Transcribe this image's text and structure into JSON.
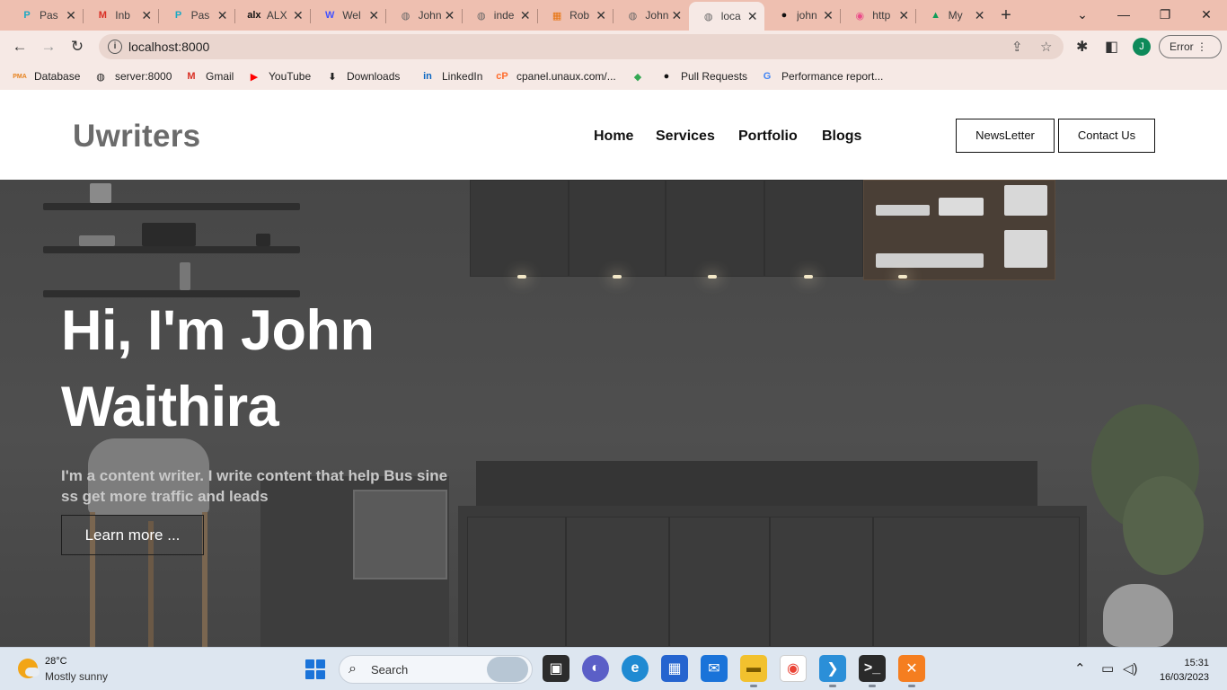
{
  "browser": {
    "tabs": [
      {
        "title": "Pas",
        "icon": "pabbly-icon",
        "color": "#1aa9c4",
        "glyph": "P"
      },
      {
        "title": "Inb",
        "icon": "gmail-icon",
        "color": "#d93025",
        "glyph": "M"
      },
      {
        "title": "Pas",
        "icon": "pabbly-icon",
        "color": "#1aa9c4",
        "glyph": "P"
      },
      {
        "title": "ALX",
        "icon": "alx-icon",
        "color": "#111111",
        "glyph": "alx"
      },
      {
        "title": "Wel",
        "icon": "webflow-icon",
        "color": "#4353ff",
        "glyph": "W"
      },
      {
        "title": "John",
        "icon": "globe-icon",
        "color": "#666666",
        "glyph": "◍"
      },
      {
        "title": "inde",
        "icon": "globe-icon",
        "color": "#666666",
        "glyph": "◍"
      },
      {
        "title": "Rob",
        "icon": "grid-app-icon",
        "color": "#e8710a",
        "glyph": "▦"
      },
      {
        "title": "John",
        "icon": "globe-icon",
        "color": "#666666",
        "glyph": "◍"
      },
      {
        "title": "loca",
        "icon": "globe-icon",
        "color": "#666666",
        "glyph": "◍",
        "active": true
      },
      {
        "title": "john",
        "icon": "github-icon",
        "color": "#111111",
        "glyph": "●"
      },
      {
        "title": "http",
        "icon": "dribbble-icon",
        "color": "#ea4c89",
        "glyph": "◉"
      },
      {
        "title": "My",
        "icon": "google-drive-icon",
        "color": "#0f9d58",
        "glyph": "▲"
      }
    ],
    "url": "localhost:8000",
    "profile_initial": "J",
    "error_label": "Error",
    "bookmarks": [
      {
        "label": "Database",
        "icon": "phpmyadmin-icon",
        "glyph": "PMA",
        "color": "#e6821e"
      },
      {
        "label": "server:8000",
        "icon": "globe-icon",
        "glyph": "◍",
        "color": "#222222"
      },
      {
        "label": "Gmail",
        "icon": "gmail-icon",
        "glyph": "M",
        "color": "#d93025"
      },
      {
        "label": "YouTube",
        "icon": "youtube-icon",
        "glyph": "▶",
        "color": "#ff0000"
      },
      {
        "label": "Downloads",
        "icon": "download-icon",
        "glyph": "⬇",
        "color": "#222222"
      },
      {
        "label": "LinkedIn",
        "icon": "linkedin-icon",
        "glyph": "in",
        "color": "#0a66c2"
      },
      {
        "label": "cpanel.unaux.com/...",
        "icon": "cpanel-icon",
        "glyph": "cP",
        "color": "#ff6c2c"
      },
      {
        "label": "",
        "icon": "google-maps-icon",
        "glyph": "◆",
        "color": "#34a853"
      },
      {
        "label": "Pull Requests",
        "icon": "github-icon",
        "glyph": "●",
        "color": "#111111"
      },
      {
        "label": "Performance report...",
        "icon": "google-icon",
        "glyph": "G",
        "color": "#4285f4"
      }
    ]
  },
  "site": {
    "logo": "Uwriters",
    "nav": [
      "Home",
      "Services",
      "Portfolio",
      "Blogs"
    ],
    "newsletter_label": "NewsLetter",
    "contact_label": "Contact Us",
    "hero": {
      "title_line1": "Hi, I'm John",
      "title_line2": "Waithira",
      "subtitle": "I'm a content writer. I write content that help Bus siness get more traffic and leads",
      "cta": "Learn more ..."
    }
  },
  "taskbar": {
    "temperature": "28°C",
    "condition": "Mostly sunny",
    "search_placeholder": "Search",
    "time": "15:31",
    "date": "16/03/2023",
    "accent": "#1a6fd0"
  }
}
